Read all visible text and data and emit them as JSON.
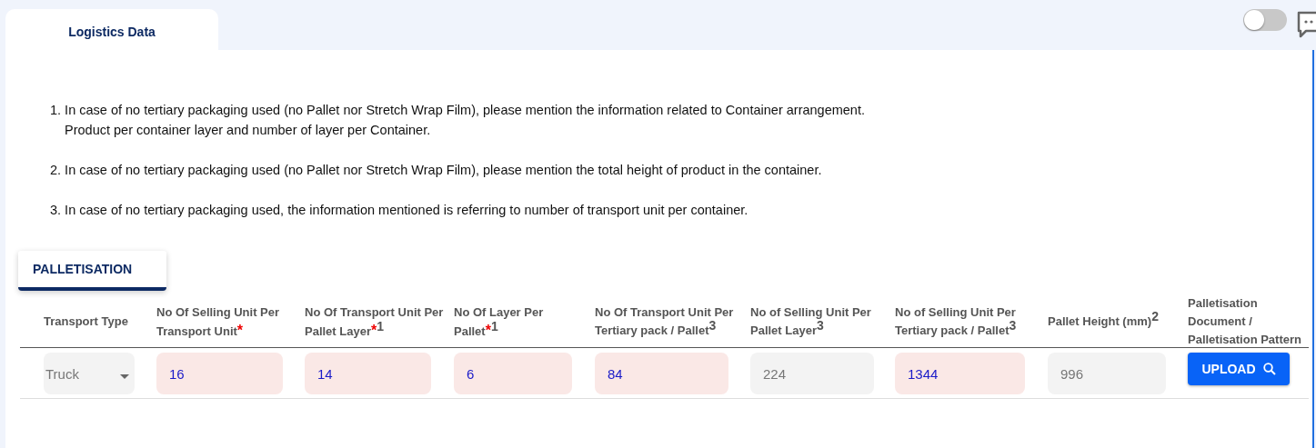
{
  "tabs": [
    {
      "label": "Logistics Data",
      "selected": true
    }
  ],
  "toggle": {
    "on": false
  },
  "notes": [
    {
      "lines": [
        "1. In case of no tertiary packaging used (no Pallet nor Stretch Wrap Film), please mention the information related to Container arrangement.",
        "Product per container layer and number of layer per Container."
      ]
    },
    {
      "lines": [
        "2. In case of no tertiary packaging used (no Pallet nor Stretch Wrap Film), please mention the total height of product in the container."
      ]
    },
    {
      "lines": [
        "3. In case of no tertiary packaging used, the information mentioned is referring to number of transport unit per container."
      ]
    }
  ],
  "section": {
    "label": "PALLETISATION"
  },
  "table": {
    "columns": [
      {
        "label": "Transport Type"
      },
      {
        "label": "No Of Selling Unit Per Transport Unit",
        "mark": "*"
      },
      {
        "label": "No Of Transport Unit Per Pallet Layer",
        "mark": "*",
        "note": "1"
      },
      {
        "label": "No Of Layer Per Pallet",
        "mark": "*",
        "note": "1"
      },
      {
        "label": "No Of Transport Unit Per Tertiary pack / Pallet",
        "note": "3"
      },
      {
        "label": "No of Selling Unit Per Pallet Layer",
        "note": "3"
      },
      {
        "label": "No of Selling Unit Per Tertiary pack / Pallet",
        "note": "3"
      },
      {
        "label": "Pallet Height (mm)",
        "note": "2"
      },
      {
        "label": "Palletisation Document / Palletisation Pattern"
      }
    ],
    "rows": [
      {
        "cells": [
          {
            "kind": "select",
            "value": "Truck"
          },
          {
            "kind": "input",
            "value": "16"
          },
          {
            "kind": "input",
            "value": "14"
          },
          {
            "kind": "input",
            "value": "6"
          },
          {
            "kind": "input",
            "value": "84"
          },
          {
            "kind": "readonly",
            "value": "224"
          },
          {
            "kind": "input",
            "value": "1344"
          },
          {
            "kind": "readonly",
            "value": "996"
          },
          {
            "kind": "button",
            "value": "UPLOAD"
          }
        ]
      }
    ]
  }
}
